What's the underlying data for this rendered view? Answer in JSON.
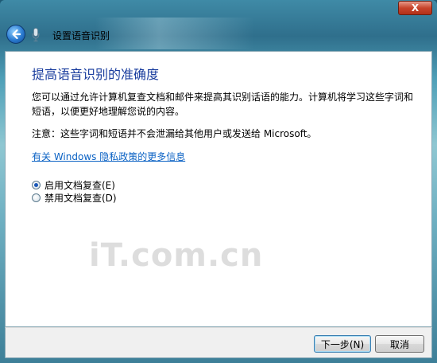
{
  "window": {
    "close_label": "X"
  },
  "toolbar": {
    "title": "设置语音识别"
  },
  "page": {
    "heading": "提高语音识别的准确度",
    "description": "您可以通过允许计算机复查文档和邮件来提高其识别话语的能力。计算机将学习这些字词和短语，以便更好地理解您说的内容。",
    "note": "注意：这些字词和短语并不会泄漏给其他用户或发送给 Microsoft。",
    "privacy_link": "有关 Windows 隐私政策的更多信息"
  },
  "options": [
    {
      "label": "启用文档复查(E)",
      "selected": true
    },
    {
      "label": "禁用文档复查(D)",
      "selected": false
    }
  ],
  "buttons": {
    "next": "下一步(N)",
    "cancel": "取消"
  },
  "watermark": {
    "text": "iT.com.cn"
  },
  "icons": {
    "back": "back-arrow-icon",
    "mic": "microphone-icon",
    "close": "close-icon"
  }
}
